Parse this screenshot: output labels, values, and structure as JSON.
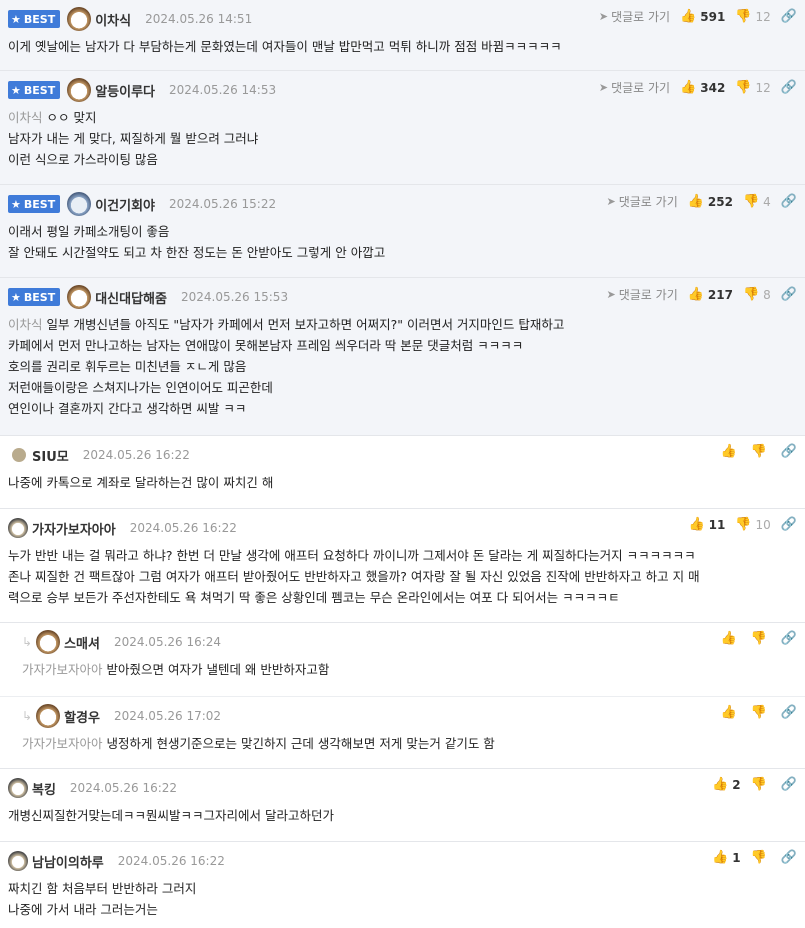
{
  "ui": {
    "best_label": "BEST",
    "goto_label": "댓글로 가기"
  },
  "comments": [
    {
      "best": true,
      "nick": "이차식",
      "date": "2024.05.26 14:51",
      "likes": "591",
      "dislikes": "12",
      "mention": "",
      "lines": [
        "이게 옛날에는 남자가 다 부담하는게 문화였는데 여자들이 맨날 밥만먹고 먹튀 하니까 점점 바뀜ㅋㅋㅋㅋㅋ"
      ]
    },
    {
      "best": true,
      "nick": "알등이루다",
      "date": "2024.05.26 14:53",
      "likes": "342",
      "dislikes": "12",
      "mention": "이차식",
      "lines": [
        "ㅇㅇ 맞지",
        "남자가 내는 게 맞다, 찌질하게 뭘 받으려 그러냐",
        "이런 식으로 가스라이팅 많음"
      ]
    },
    {
      "best": true,
      "nick": "이건기회야",
      "date": "2024.05.26 15:22",
      "likes": "252",
      "dislikes": "4",
      "mention": "",
      "lines": [
        "이래서 평일 카페소개팅이 좋음",
        "잘 안돼도 시간절약도 되고 차 한잔 정도는 돈 안받아도 그렇게 안 아깝고"
      ]
    },
    {
      "best": true,
      "nick": "대신대답해줌",
      "date": "2024.05.26 15:53",
      "likes": "217",
      "dislikes": "8",
      "mention": "이차식",
      "lines": [
        "일부 개병신년들 아직도 \"남자가 카페에서 먼저 보자고하면 어쩌지?\" 이러면서 거지마인드 탑재하고",
        "카페에서 먼저 만나고하는 남자는 연애많이 못해본남자 프레임 씌우더라 딱 본문 댓글처럼 ㅋㅋㅋㅋ",
        "호의를 권리로 휘두르는 미친년들 ㅈㄴ게 많음",
        "저런애들이랑은 스쳐지나가는 인연이어도 피곤한데",
        "연인이나 결혼까지 간다고 생각하면 씨발 ㅋㅋ"
      ]
    },
    {
      "best": false,
      "nick": "SIU모",
      "date": "2024.05.26 16:22",
      "likes": "",
      "dislikes": "",
      "mention": "",
      "lines": [
        "나중에 카톡으로 계좌로 달라하는건 많이 짜치긴 해"
      ]
    },
    {
      "best": false,
      "nick": "가자가보자아아",
      "date": "2024.05.26 16:22",
      "likes": "11",
      "dislikes": "10",
      "mention": "",
      "lines": [
        "누가 반반 내는 걸 뭐라고 하냐? 한번 더 만날 생각에 애프터 요청하다 까이니까 그제서야 돈 달라는 게 찌질하다는거지 ㅋㅋㅋㅋㅋㅋ",
        "존나 찌질한 건 팩트잖아 그럼 여자가 애프터 받아줬어도 반반하자고 했을까? 여자랑 잘 될 자신 있었음 진작에 반반하자고 하고 지 매",
        "력으로 승부 보든가 주선자한테도 욕 쳐먹기 딱 좋은 상황인데 펨코는 무슨 온라인에서는 여포 다 되어서는 ㅋㅋㅋㅋㅌ"
      ]
    },
    {
      "best": false,
      "reply": true,
      "nick": "스매셔",
      "date": "2024.05.26 16:24",
      "likes": "",
      "dislikes": "",
      "mention": "가자가보자아아",
      "lines": [
        "받아줬으면 여자가 낼텐데 왜 반반하자고함"
      ]
    },
    {
      "best": false,
      "reply": true,
      "nick": "할경우",
      "date": "2024.05.26 17:02",
      "likes": "",
      "dislikes": "",
      "mention": "가자가보자아아",
      "lines": [
        "냉정하게 현생기준으로는 맞긴하지 근데 생각해보면 저게 맞는거 같기도 함"
      ]
    },
    {
      "best": false,
      "nick": "복킹",
      "date": "2024.05.26 16:22",
      "likes": "2",
      "dislikes": "",
      "mention": "",
      "lines": [
        "개병신찌질한거맞는데ㅋㅋ뭔씨발ㅋㅋ그자리에서 달라고하던가"
      ]
    },
    {
      "best": false,
      "nick": "남남이의하루",
      "date": "2024.05.26 16:22",
      "likes": "1",
      "dislikes": "",
      "mention": "",
      "lines": [
        "짜치긴 함 처음부터 반반하라 그러지",
        "나중에 가서 내라 그러는거는"
      ]
    }
  ]
}
